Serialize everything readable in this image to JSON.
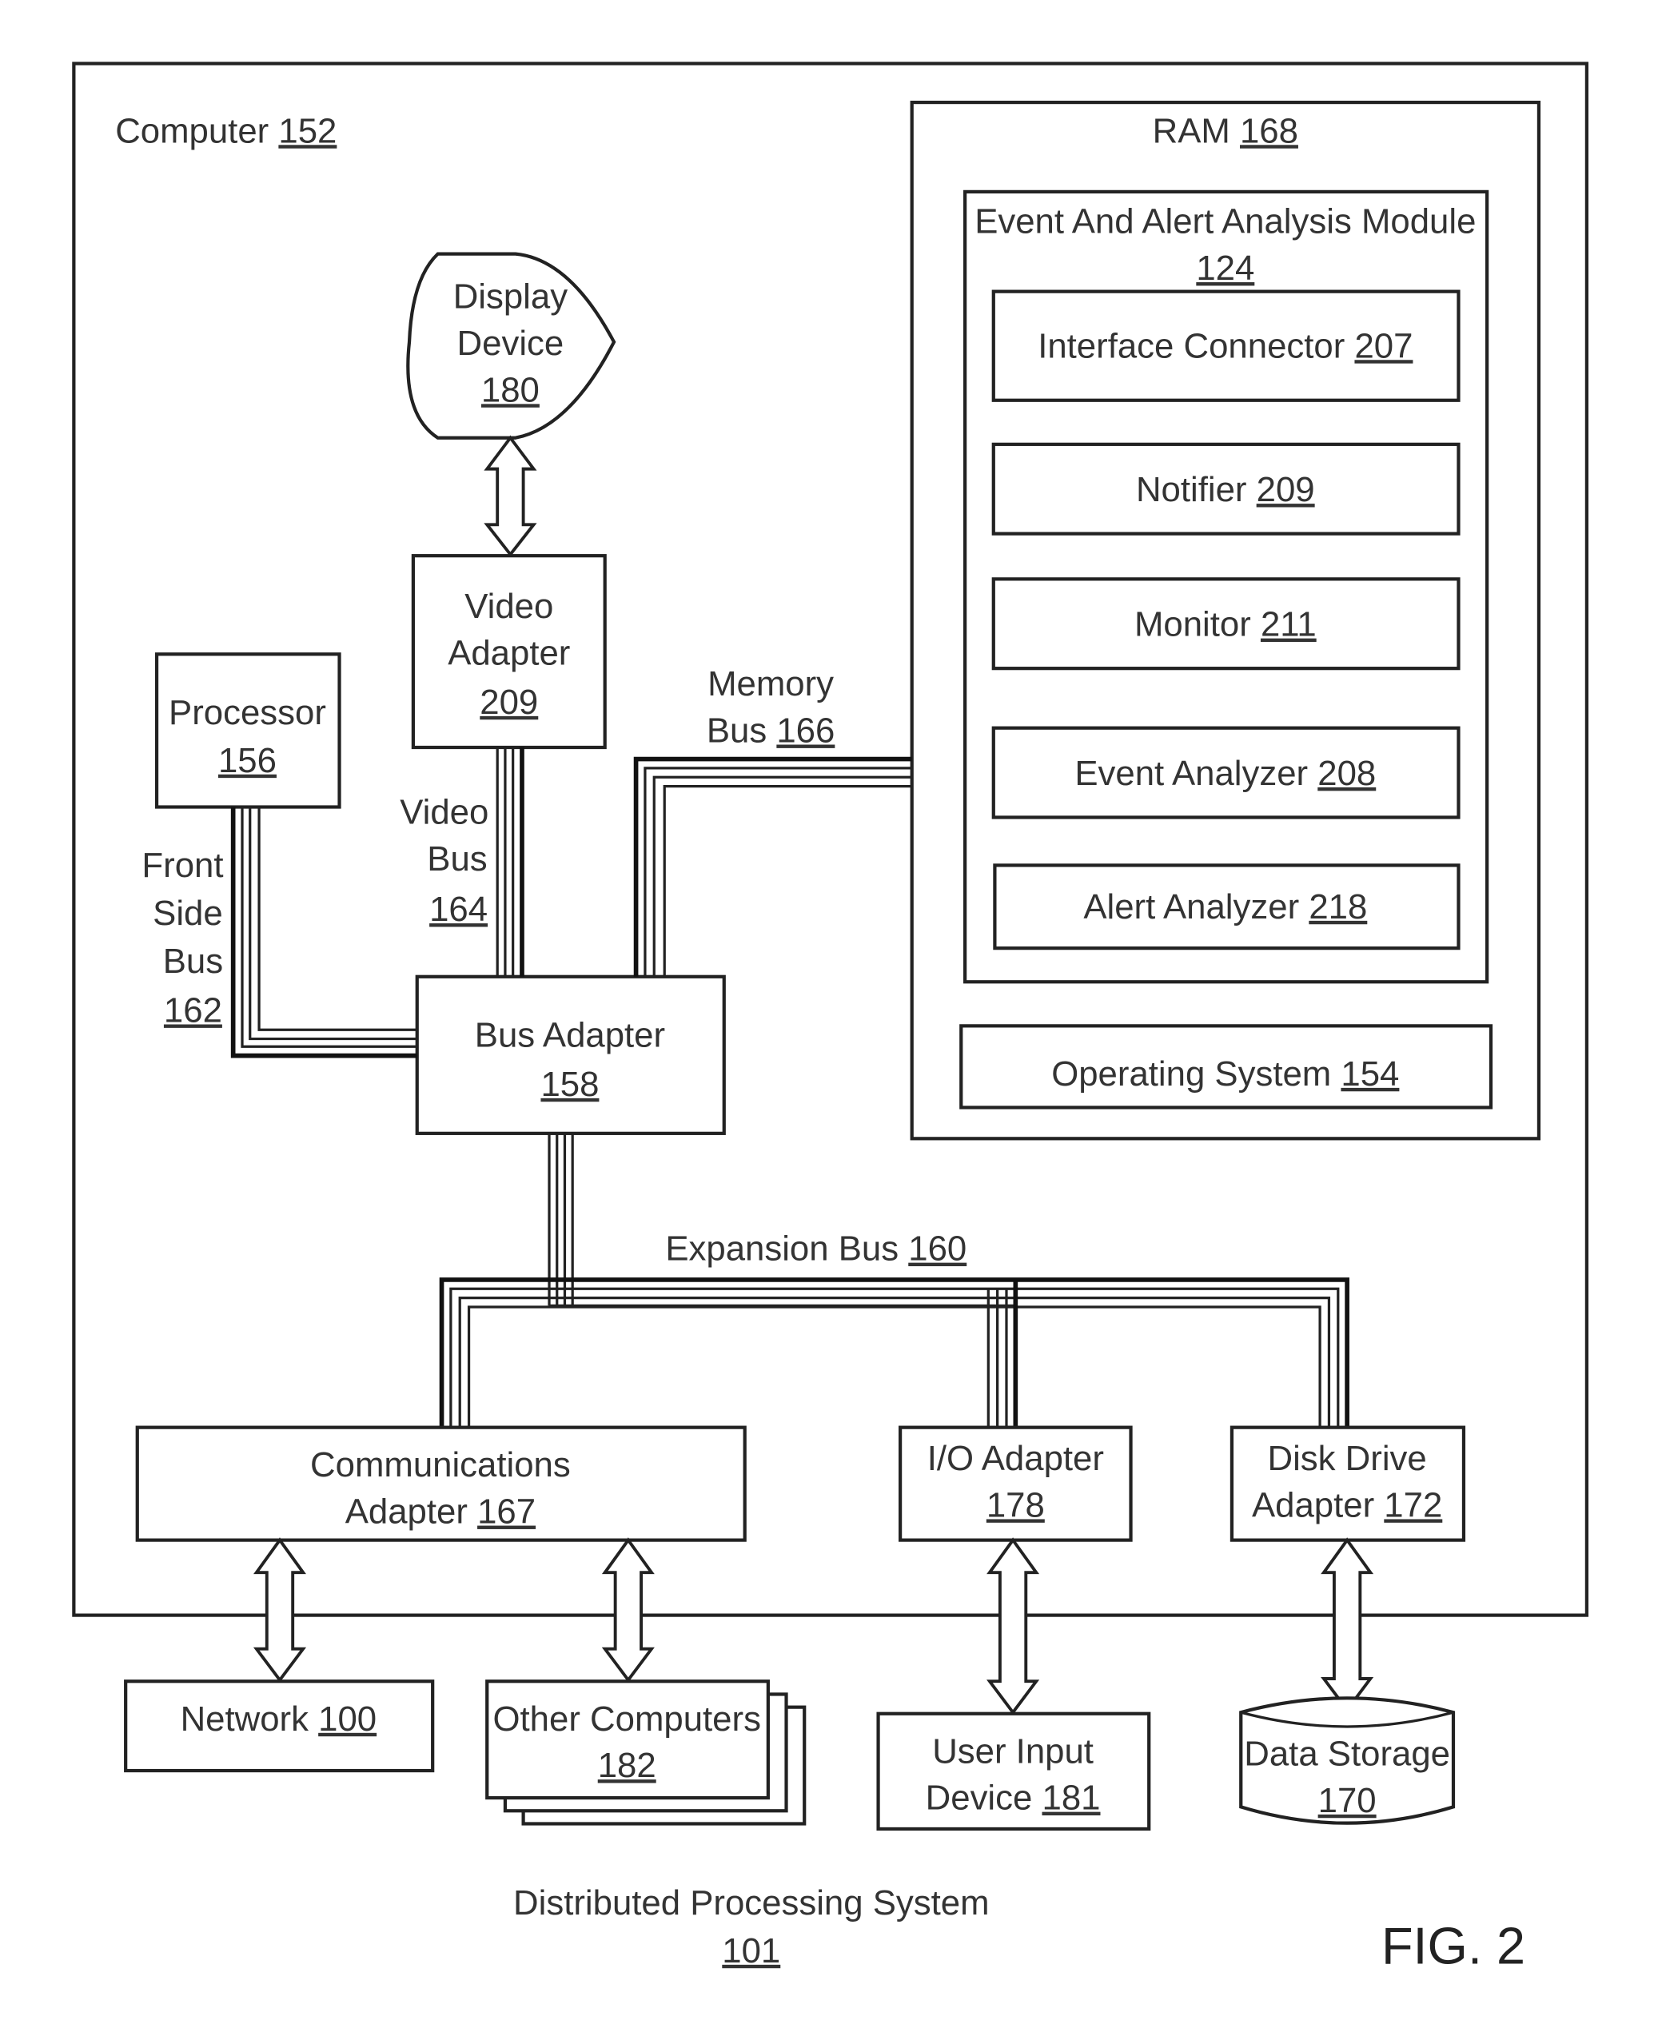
{
  "figure_label": "FIG. 2",
  "system": {
    "title": "Distributed Processing System",
    "ref": "101"
  },
  "computer": {
    "title": "Computer",
    "ref": "152"
  },
  "ram": {
    "title": "RAM",
    "ref": "168"
  },
  "module": {
    "title": "Event And Alert Analysis Module",
    "ref": "124"
  },
  "module_items": [
    {
      "title": "Interface Connector",
      "ref": "207"
    },
    {
      "title": "Notifier",
      "ref": "209"
    },
    {
      "title": "Monitor",
      "ref": "211"
    },
    {
      "title": "Event Analyzer",
      "ref": "208"
    },
    {
      "title": "Alert Analyzer",
      "ref": "218"
    }
  ],
  "operating_system": {
    "title": "Operating System",
    "ref": "154"
  },
  "display_device": {
    "line1": "Display",
    "line2": "Device",
    "ref": "180"
  },
  "video_adapter": {
    "line1": "Video",
    "line2": "Adapter",
    "ref": "209"
  },
  "processor": {
    "line1": "Processor",
    "ref": "156"
  },
  "bus_adapter": {
    "line1": "Bus Adapter",
    "ref": "158"
  },
  "front_side_bus": {
    "line1": "Front",
    "line2": "Side",
    "line3": "Bus",
    "ref": "162"
  },
  "video_bus": {
    "line1": "Video",
    "line2": "Bus",
    "ref": "164"
  },
  "memory_bus": {
    "line1": "Memory",
    "line2": "Bus",
    "ref": "166"
  },
  "expansion_bus": {
    "title": "Expansion Bus",
    "ref": "160"
  },
  "comm_adapter": {
    "line1": "Communications",
    "line2": "Adapter",
    "ref": "167"
  },
  "io_adapter": {
    "line1": "I/O Adapter",
    "ref": "178"
  },
  "disk_adapter": {
    "line1": "Disk Drive",
    "line2": "Adapter",
    "ref": "172"
  },
  "network": {
    "title": "Network",
    "ref": "100"
  },
  "other_computers": {
    "line1": "Other Computers",
    "ref": "182"
  },
  "user_input": {
    "line1": "User Input",
    "line2": "Device",
    "ref": "181"
  },
  "data_storage": {
    "line1": "Data Storage",
    "ref": "170"
  }
}
